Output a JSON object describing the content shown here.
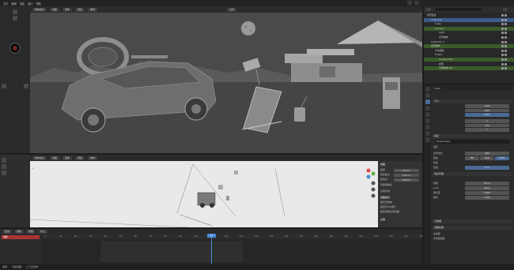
{
  "topbar": {
    "menu": [
      "文件",
      "编辑",
      "渲染",
      "窗口",
      "帮助"
    ],
    "tabs": [
      "布局",
      "建模",
      "雕刻",
      "UV编辑",
      "纹理绘制",
      "着色",
      "动画",
      "渲染",
      "合成",
      "几何节点",
      "脚本"
    ]
  },
  "viewport": {
    "header": {
      "mode": "物体模式",
      "view": "视图",
      "select": "选择",
      "add": "添加",
      "object": "物体",
      "transform": "全局"
    }
  },
  "camview": {
    "header": {
      "mode": "物体模式",
      "view": "视图",
      "select": "选择",
      "add": "添加",
      "object": "物体"
    },
    "npanel": {
      "section_view": "视图",
      "focal_label": "焦距",
      "focal_value": "50 mm",
      "clip_start_label": "裁剪起点",
      "clip_start_value": "0.01 m",
      "clip_end_label": "结束点",
      "clip_end_value": "1000 m",
      "local_camera_label": "局部摄像机",
      "render_region_label": "渲染区域",
      "view_lock_label": "视图锁定",
      "lock_object_label": "锁定至物体",
      "lock_3d_cursor_label": "锁定至3D游标",
      "lock_camera_label": "锁定摄像机到视图",
      "annotation_label": "注释"
    }
  },
  "timeline": {
    "header": [
      "回放",
      "抠像",
      "视图",
      "标记"
    ],
    "key_label": "摘要",
    "current_frame": "25",
    "ticks": [
      "0",
      "10",
      "20",
      "30",
      "40",
      "50",
      "60",
      "70",
      "80",
      "90",
      "100",
      "110",
      "120",
      "130",
      "140",
      "150",
      "160",
      "170",
      "180",
      "190",
      "200",
      "210",
      "220",
      "230",
      "240",
      "250"
    ]
  },
  "statusbar": {
    "items": [
      "选择",
      "平移视图",
      "上下文菜单"
    ]
  },
  "outliner": {
    "rows": [
      {
        "label": "场景集合",
        "indent": 0,
        "highlight": "none"
      },
      {
        "label": "Collection",
        "indent": 1,
        "highlight": "blue"
      },
      {
        "label": "Cube",
        "indent": 2,
        "highlight": "none"
      },
      {
        "label": "Camera",
        "indent": 2,
        "highlight": "green"
      },
      {
        "label": "Light",
        "indent": 3,
        "highlight": "none"
      },
      {
        "label": "背景物体",
        "indent": 3,
        "highlight": "none"
      },
      {
        "label": "Collection 2",
        "indent": 1,
        "highlight": "none"
      },
      {
        "label": "场景物体",
        "indent": 1,
        "highlight": "green"
      },
      {
        "label": "汽车模型",
        "indent": 2,
        "highlight": "none"
      },
      {
        "label": "Empty",
        "indent": 2,
        "highlight": "none"
      },
      {
        "label": "Camera.001",
        "indent": 3,
        "highlight": "green"
      },
      {
        "label": "材质",
        "indent": 3,
        "highlight": "none"
      },
      {
        "label": "背景物体.001",
        "indent": 3,
        "highlight": "green"
      }
    ]
  },
  "props": {
    "header_title": "Cube",
    "sections": {
      "motion": "运动",
      "dimensions": "尺寸",
      "output": "输出",
      "output_path": "/tmp/render/",
      "saving": "保存",
      "file_format": "文件格式",
      "format_value": "PNG",
      "color": "颜色",
      "color_options": [
        "BW",
        "RGB",
        "RGBA"
      ],
      "color_depth": "色深",
      "compression": "压缩",
      "color_management": "色彩管理",
      "view": "视图",
      "look": "Look",
      "exposure": "曝光度",
      "gamma": "伽玛",
      "metadata": "元数据",
      "post_processing": "后期处理",
      "pipeline": "合成器",
      "sequencer": "序列编辑器"
    },
    "fields": {
      "res_x": "1920",
      "res_y": "1080",
      "percent": "100%",
      "frame_start": "1",
      "frame_end": "250",
      "step": "1",
      "compression_value": "15%",
      "view_transform": "Filmic",
      "look_value": "None",
      "exposure_value": "0.000",
      "gamma_value": "1.000"
    }
  }
}
